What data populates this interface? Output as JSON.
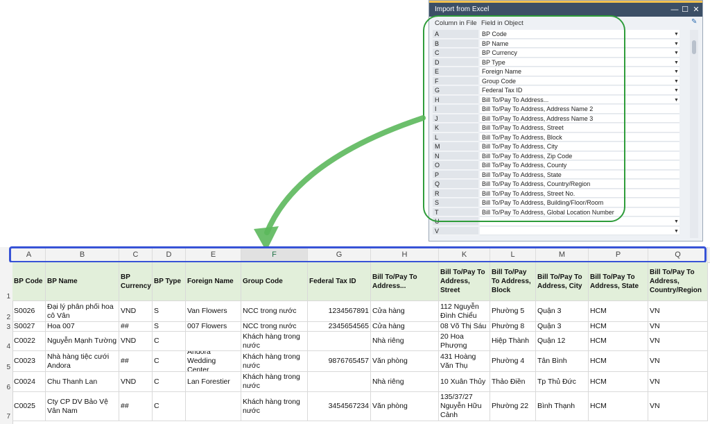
{
  "dialog": {
    "title": "Import from Excel",
    "minimize_glyph": "—",
    "maximize_glyph": "☐",
    "close_glyph": "✕",
    "col_header": "Column in File",
    "field_header": "Field in Object",
    "dropdown_glyph": "▼",
    "edit_glyph": "✎",
    "rows": [
      {
        "col": "A",
        "field": "BP Code",
        "dropdown": true
      },
      {
        "col": "B",
        "field": "BP Name",
        "dropdown": true
      },
      {
        "col": "C",
        "field": "BP Currency",
        "dropdown": true
      },
      {
        "col": "D",
        "field": "BP Type",
        "dropdown": true
      },
      {
        "col": "E",
        "field": "Foreign Name",
        "dropdown": true
      },
      {
        "col": "F",
        "field": "Group Code",
        "dropdown": true
      },
      {
        "col": "G",
        "field": "Federal Tax ID",
        "dropdown": true
      },
      {
        "col": "H",
        "field": "Bill To/Pay To Address...",
        "dropdown": true
      },
      {
        "col": "I",
        "field": "Bill To/Pay To Address, Address Name 2",
        "dropdown": false
      },
      {
        "col": "J",
        "field": "Bill To/Pay To Address, Address Name 3",
        "dropdown": false
      },
      {
        "col": "K",
        "field": "Bill To/Pay To Address, Street",
        "dropdown": false
      },
      {
        "col": "L",
        "field": "Bill To/Pay To Address, Block",
        "dropdown": false
      },
      {
        "col": "M",
        "field": "Bill To/Pay To Address, City",
        "dropdown": false
      },
      {
        "col": "N",
        "field": "Bill To/Pay To Address, Zip Code",
        "dropdown": false
      },
      {
        "col": "O",
        "field": "Bill To/Pay To Address, County",
        "dropdown": false
      },
      {
        "col": "P",
        "field": "Bill To/Pay To Address, State",
        "dropdown": false
      },
      {
        "col": "Q",
        "field": "Bill To/Pay To Address, Country/Region",
        "dropdown": false
      },
      {
        "col": "R",
        "field": "Bill To/Pay To Address, Street No.",
        "dropdown": false
      },
      {
        "col": "S",
        "field": "Bill To/Pay To Address, Building/Floor/Room",
        "dropdown": false
      },
      {
        "col": "T",
        "field": "Bill To/Pay To Address, Global Location Number",
        "dropdown": false
      },
      {
        "col": "U",
        "field": "",
        "dropdown": true
      },
      {
        "col": "V",
        "field": "",
        "dropdown": true
      }
    ]
  },
  "sheet": {
    "columns": [
      "A",
      "B",
      "C",
      "D",
      "E",
      "F",
      "G",
      "H",
      "K",
      "L",
      "M",
      "P",
      "Q"
    ],
    "active_column": "F",
    "row_numbers": [
      "1",
      "2",
      "3",
      "4",
      "5",
      "6",
      "7"
    ],
    "headers": [
      "BP Code",
      "BP Name",
      "BP Currency",
      "BP Type",
      "Foreign Name",
      "Group Code",
      "Federal Tax ID",
      "Bill To/Pay To Address...",
      "Bill To/Pay To Address, Street",
      "Bill To/Pay To Address, Block",
      "Bill To/Pay To Address, City",
      "Bill To/Pay To Address, State",
      "Bill To/Pay To Address, Country/Region"
    ],
    "rows": [
      [
        "S0026",
        "Đại lý phân phối hoa cô Vân",
        "VND",
        "S",
        "Van Flowers",
        "NCC trong nước",
        "1234567891",
        "Cửa hàng",
        "112 Nguyễn Đình Chiểu",
        "Phường 5",
        "Quận 3",
        "HCM",
        "VN"
      ],
      [
        "S0027",
        "Hoa 007",
        "##",
        "S",
        "007 Flowers",
        "NCC trong nước",
        "2345654565",
        "Cửa hàng",
        "08 Võ Thị Sáu",
        "Phường 8",
        "Quận 3",
        "HCM",
        "VN"
      ],
      [
        "C0022",
        "Nguyễn Mạnh Tường",
        "VND",
        "C",
        "",
        "Khách hàng trong nước",
        "",
        "Nhà riêng",
        "20 Hoa Phượng",
        "Hiệp Thành",
        "Quận 12",
        "HCM",
        "VN"
      ],
      [
        "C0023",
        "Nhà hàng tiệc cưới Andora",
        "##",
        "C",
        "Andora Wedding Center",
        "Khách hàng trong nước",
        "9876765457",
        "Văn phòng",
        "431 Hoàng Văn Thụ",
        "Phường 4",
        "Tân Bình",
        "HCM",
        "VN"
      ],
      [
        "C0024",
        "Chu Thanh Lan",
        "VND",
        "C",
        "Lan Forestier",
        "Khách hàng trong nước",
        "",
        "Nhà riêng",
        "10 Xuân Thủy",
        "Thảo Điền",
        "Tp Thủ Đức",
        "HCM",
        "VN"
      ],
      [
        "C0025",
        "Cty CP DV Bảo Vệ Vân Nam",
        "##",
        "C",
        "",
        "Khách hàng trong nước",
        "3454567234",
        "Văn phòng",
        "135/37/27 Nguyễn Hữu Cảnh",
        "Phường 22",
        "Bình Thạnh",
        "HCM",
        "VN"
      ]
    ],
    "numeric_columns": [
      6
    ]
  },
  "colors": {
    "header_fill": "#e2efda",
    "highlight_green": "#2e9c3a",
    "frame_blue": "#3753d6",
    "dialog_titlebar": "#3c4f66"
  }
}
